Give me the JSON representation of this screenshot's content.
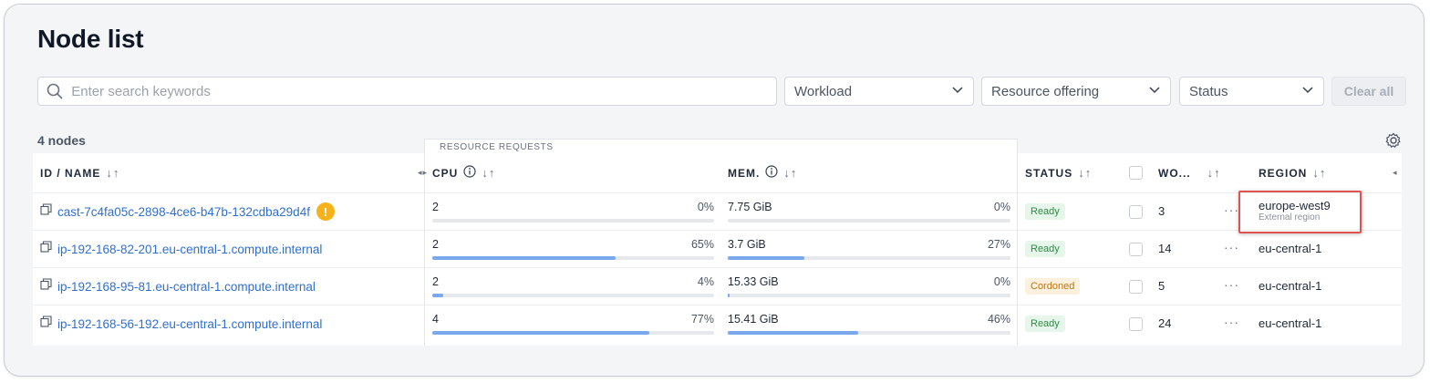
{
  "page": {
    "title": "Node list",
    "node_count": "4 nodes"
  },
  "filters": {
    "search_placeholder": "Enter search keywords",
    "workload": "Workload",
    "resource_offering": "Resource offering",
    "status": "Status",
    "clear_all": "Clear all"
  },
  "table": {
    "group_header": "RESOURCE REQUESTS",
    "headers": {
      "name": "ID / NAME",
      "cpu": "CPU",
      "mem": "MEM.",
      "status": "STATUS",
      "workloads": "WO...",
      "region": "REGION"
    },
    "rows": [
      {
        "name": "cast-7c4fa05c-2898-4ce6-b47b-132cdba29d4f",
        "warning": "!",
        "cpu": "2",
        "cpu_pct": "0%",
        "cpu_fill": 0,
        "mem": "7.75 GiB",
        "mem_pct": "0%",
        "mem_fill": 0,
        "status": "Ready",
        "workloads": "3",
        "region": "europe-west9",
        "region_sub": "External region"
      },
      {
        "name": "ip-192-168-82-201.eu-central-1.compute.internal",
        "cpu": "2",
        "cpu_pct": "65%",
        "cpu_fill": 65,
        "mem": "3.7 GiB",
        "mem_pct": "27%",
        "mem_fill": 27,
        "status": "Ready",
        "workloads": "14",
        "region": "eu-central-1"
      },
      {
        "name": "ip-192-168-95-81.eu-central-1.compute.internal",
        "cpu": "2",
        "cpu_pct": "4%",
        "cpu_fill": 4,
        "mem": "15.33 GiB",
        "mem_pct": "0%",
        "mem_fill": 0.5,
        "status": "Cordoned",
        "workloads": "5",
        "region": "eu-central-1"
      },
      {
        "name": "ip-192-168-56-192.eu-central-1.compute.internal",
        "cpu": "4",
        "cpu_pct": "77%",
        "cpu_fill": 77,
        "mem": "15.41 GiB",
        "mem_pct": "46%",
        "mem_fill": 46,
        "status": "Ready",
        "workloads": "24",
        "region": "eu-central-1"
      }
    ]
  },
  "icons": {
    "search": "search-icon",
    "chevron": "chevron-down-icon",
    "settings": "gear-icon",
    "copy": "copy-icon",
    "info": "info-icon",
    "sort": "sort-icon"
  },
  "colors": {
    "link": "#2f6fd1",
    "bar_fill": "#7aa8ee",
    "ready_bg": "#e7f6ea",
    "ready_text": "#2e8a45",
    "cordoned_bg": "#fdf0dc",
    "cordoned_text": "#c4730c",
    "warning": "#f5b21b",
    "highlight": "#e0524d"
  }
}
